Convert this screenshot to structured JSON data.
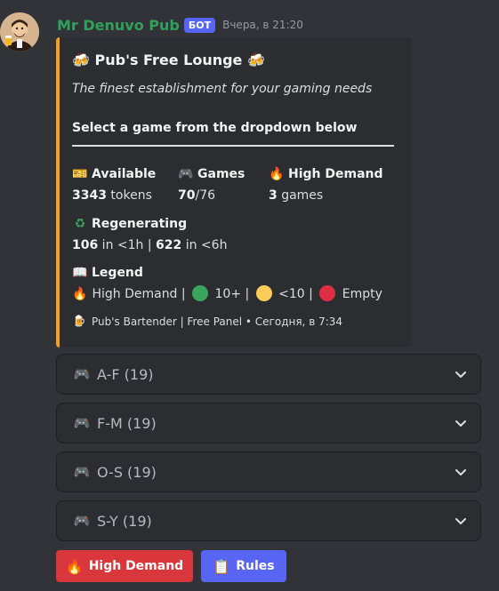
{
  "message": {
    "username": "Mr Denuvo Pub",
    "bot_badge": "БОТ",
    "timestamp": "Вчера, в 21:20"
  },
  "embed": {
    "accent_color": "#f0a020",
    "title": "🍻 Pub's Free Lounge 🍻",
    "description": "The finest establishment for your gaming needs",
    "select_heading": "Select a game from the dropdown below",
    "fields": {
      "available": {
        "name": "Available",
        "icon": "ticket-icon",
        "value_bold": "3343",
        "value_rest": " tokens"
      },
      "games": {
        "name": "Games",
        "icon": "gamepad-icon",
        "value_bold": "70",
        "value_rest": "/76"
      },
      "high_demand": {
        "name": "High Demand",
        "icon": "fire-icon",
        "value_bold": "3",
        "value_rest": " games"
      },
      "regenerating": {
        "name": "Regenerating",
        "icon": "recycle-icon",
        "v1_bold": "106",
        "v1_rest": " in <1h | ",
        "v2_bold": "622",
        "v2_rest": " in <6h"
      },
      "legend": {
        "name": "Legend",
        "icon": "book-icon",
        "t1": " High Demand | ",
        "t2": " 10+ | ",
        "t3": " <10 | ",
        "t4": " Empty"
      }
    },
    "footer": "Pub's Bartender | Free Panel • Сегодня, в 7:34"
  },
  "dropdowns": [
    {
      "label": "A-F (19)"
    },
    {
      "label": "F-M (19)"
    },
    {
      "label": "O-S (19)"
    },
    {
      "label": "S-Y (19)"
    }
  ],
  "buttons": {
    "high_demand": {
      "label": "High Demand",
      "color": "#da373c"
    },
    "rules": {
      "label": "Rules",
      "color": "#5865f2"
    }
  },
  "colors": {
    "green": "#2fa15a",
    "status_green": "#3ba55d",
    "status_yellow": "#fdcb58",
    "status_red": "#dd2e44"
  }
}
